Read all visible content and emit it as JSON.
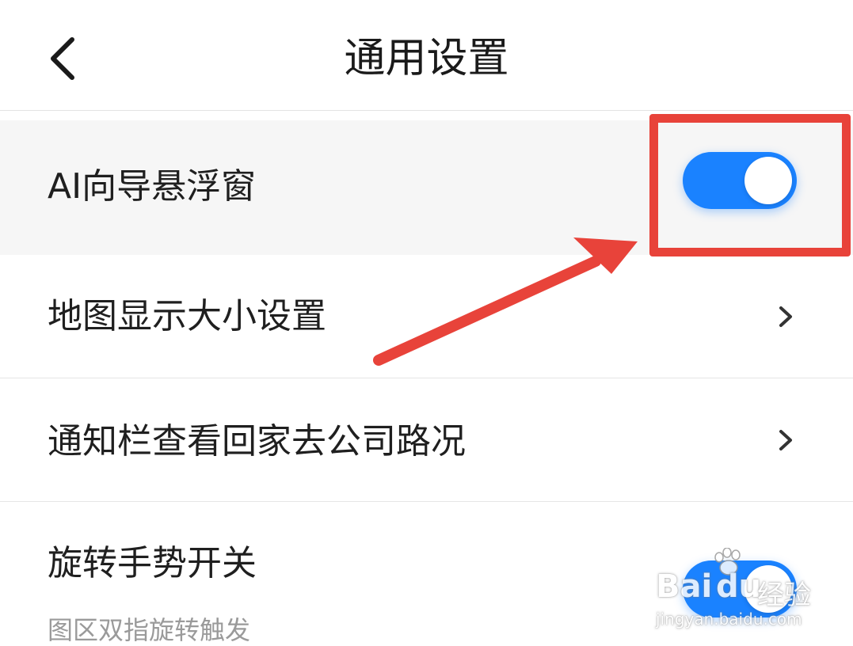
{
  "header": {
    "title": "通用设置"
  },
  "settings": {
    "ai_float": {
      "label": "AI向导悬浮窗",
      "enabled": true
    },
    "map_size": {
      "label": "地图显示大小设置"
    },
    "notify_route": {
      "label": "通知栏查看回家去公司路况"
    },
    "rotate_gesture": {
      "label": "旋转手势开关",
      "subtitle": "图区双指旋转触发",
      "enabled": true
    }
  },
  "watermark": {
    "brand": "Bai",
    "brand2": "du",
    "cn": "经验",
    "url": "jingyan.baidu.com"
  },
  "colors": {
    "toggle_on": "#1a82ff",
    "annotation_red": "#e8433a"
  }
}
